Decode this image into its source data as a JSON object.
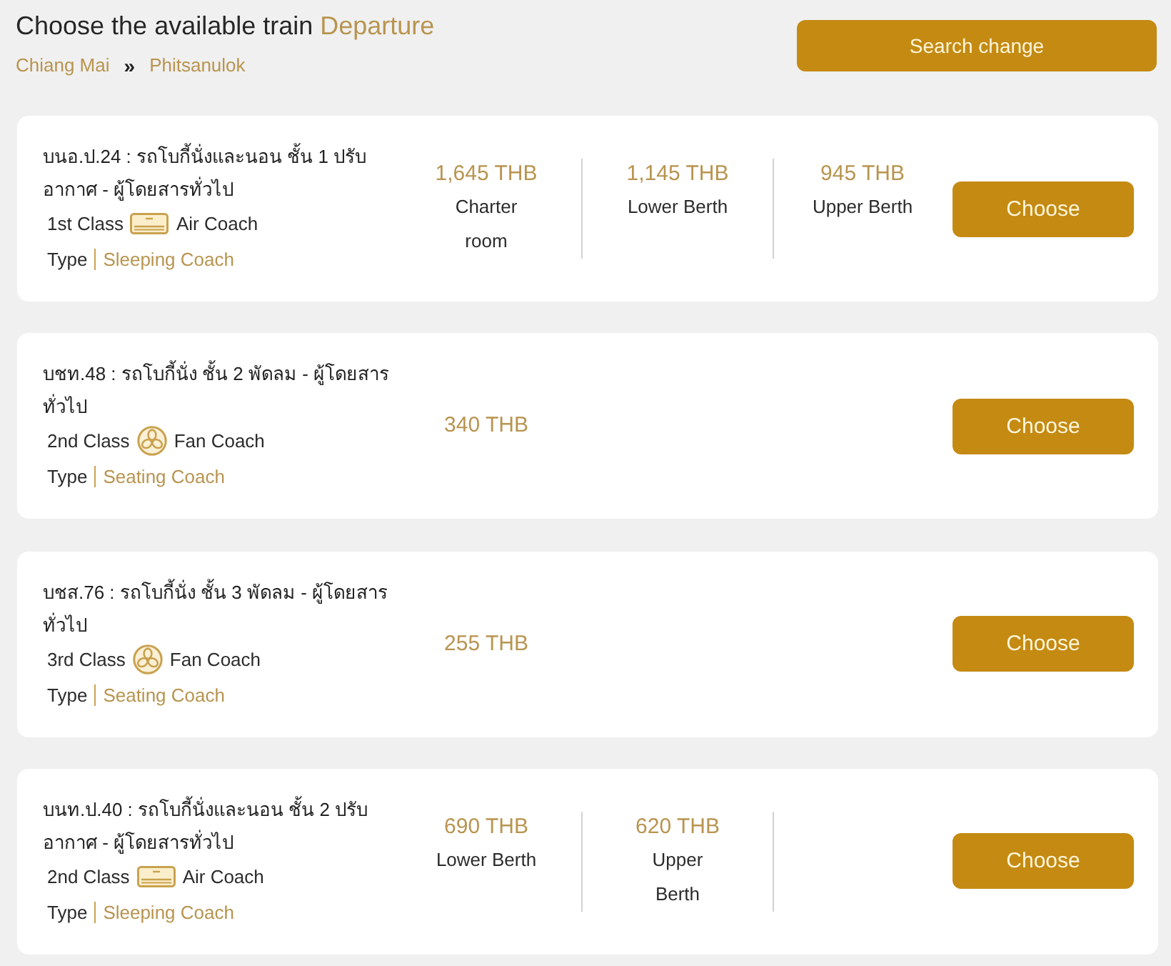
{
  "header": {
    "title": "Choose the available train",
    "direction": "Departure",
    "search_button": "Search change"
  },
  "route": {
    "from": "Chiang Mai",
    "separator": "»",
    "to": "Phitsanulok"
  },
  "trains": [
    {
      "name": "บนอ.ป.24 : รถโบกี้นั่งและนอน ชั้น 1 ปรับ\nอากาศ - ผู้โดยสารทั่วไป",
      "class": "1st Class",
      "coach": {
        "kind": "air",
        "label": "Air Coach"
      },
      "type_label": "Type",
      "type": "Sleeping Coach",
      "fares": [
        {
          "price": "1,645 THB",
          "label": "Charter\nroom"
        },
        {
          "price": "1,145 THB",
          "label": "Lower Berth"
        },
        {
          "price": "945 THB",
          "label": "Upper Berth"
        }
      ],
      "button": "Choose"
    },
    {
      "name": "บชท.48 : รถโบกี้นั่ง ชั้น 2 พัดลม - ผู้โดยสาร\nทั่วไป",
      "class": "2nd Class",
      "coach": {
        "kind": "fan",
        "label": "Fan Coach"
      },
      "type_label": "Type",
      "type": "Seating Coach",
      "fares": [
        {
          "price": "340 THB"
        }
      ],
      "button": "Choose"
    },
    {
      "name": "บชส.76 : รถโบกี้นั่ง ชั้น 3 พัดลม - ผู้โดยสาร\nทั่วไป",
      "class": "3rd Class",
      "coach": {
        "kind": "fan",
        "label": "Fan Coach"
      },
      "type_label": "Type",
      "type": "Seating Coach",
      "fares": [
        {
          "price": "255 THB"
        }
      ],
      "button": "Choose"
    },
    {
      "name": "บนท.ป.40 : รถโบกี้นั่งและนอน ชั้น 2 ปรับ\nอากาศ - ผู้โดยสารทั่วไป",
      "class": "2nd Class",
      "coach": {
        "kind": "air",
        "label": "Air Coach"
      },
      "type_label": "Type",
      "type": "Sleeping Coach",
      "fares": [
        {
          "price": "690 THB",
          "label": "Lower Berth"
        },
        {
          "price": "620 THB",
          "label": "Upper\nBerth"
        }
      ],
      "button": "Choose"
    }
  ]
}
